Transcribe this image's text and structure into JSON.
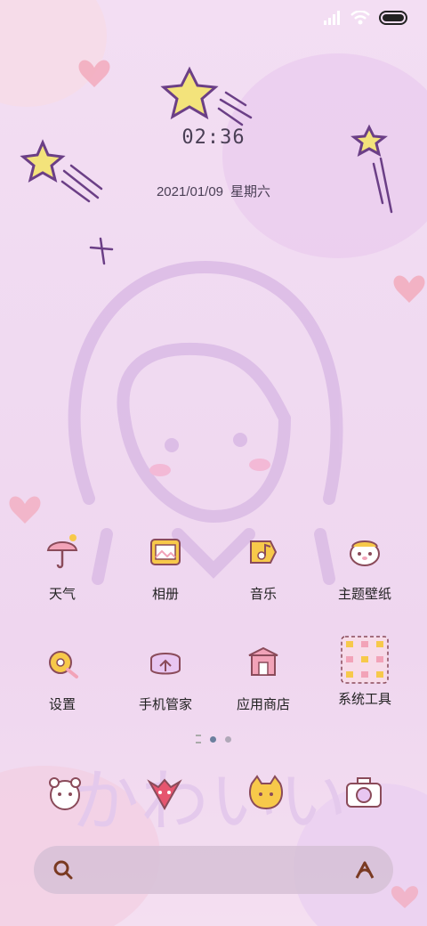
{
  "status": {
    "signal_icon": "signal-icon",
    "wifi_icon": "wifi-icon",
    "battery_icon": "battery-icon"
  },
  "clock": {
    "time": "02:36"
  },
  "date": {
    "date": "2021/01/09",
    "weekday": "星期六"
  },
  "wallpaper": {
    "watermark_text": "かわいい"
  },
  "apps": [
    {
      "label": "天气",
      "icon": "umbrella-weather-icon"
    },
    {
      "label": "相册",
      "icon": "photo-album-icon"
    },
    {
      "label": "音乐",
      "icon": "music-icon"
    },
    {
      "label": "主题壁纸",
      "icon": "theme-hamster-icon"
    },
    {
      "label": "设置",
      "icon": "settings-gear-icon"
    },
    {
      "label": "手机管家",
      "icon": "phone-manager-icon"
    },
    {
      "label": "应用商店",
      "icon": "app-store-icon"
    },
    {
      "label": "系统工具",
      "icon": "system-tools-folder-icon"
    }
  ],
  "page_indicator": {
    "pages": 3,
    "current": 2
  },
  "dock": [
    "bear-app-icon",
    "fox-app-icon",
    "cat-app-icon",
    "camera-app-icon"
  ],
  "search": {
    "search_icon": "search-icon",
    "assistant_icon": "assistant-icon"
  },
  "colors": {
    "accent": "#8a4b5a",
    "icon_pink": "#f2a3b8",
    "icon_yellow": "#f7c94a",
    "star": "#f3e37b"
  }
}
